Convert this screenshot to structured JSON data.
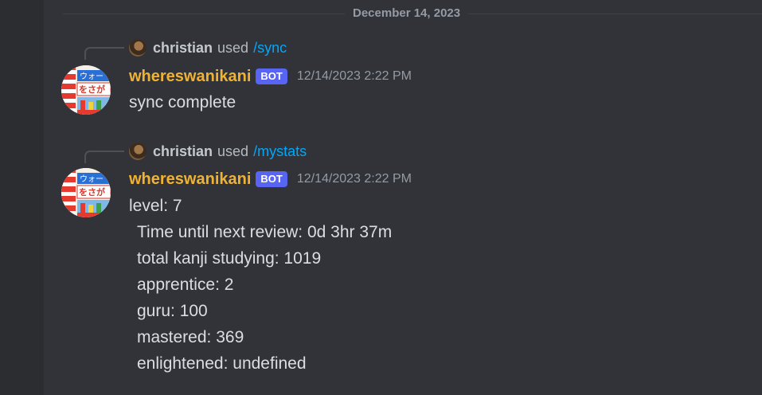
{
  "date_divider": "December 14, 2023",
  "messages": [
    {
      "reply": {
        "user": "christian",
        "verb": "used",
        "command": "/sync"
      },
      "author": "whereswanikani",
      "badge": "BOT",
      "timestamp": "12/14/2023 2:22 PM",
      "lines": [
        "sync complete"
      ]
    },
    {
      "reply": {
        "user": "christian",
        "verb": "used",
        "command": "/mystats"
      },
      "author": "whereswanikani",
      "badge": "BOT",
      "timestamp": "12/14/2023 2:22 PM",
      "lines": [
        "level: 7",
        "Time until next review: 0d 3hr 37m",
        "total kanji studying: 1019",
        "apprentice: 2",
        "guru: 100",
        "mastered: 369",
        "enlightened: undefined"
      ]
    }
  ],
  "colors": {
    "background": "#313338",
    "username": "#f0b232",
    "bot_badge": "#5865f2",
    "command_link": "#00a8fc",
    "text": "#dbdee1",
    "muted": "#949ba4"
  },
  "icons": {
    "reply_avatar": "user-avatar-icon",
    "bot_avatar": "bot-avatar-icon"
  }
}
